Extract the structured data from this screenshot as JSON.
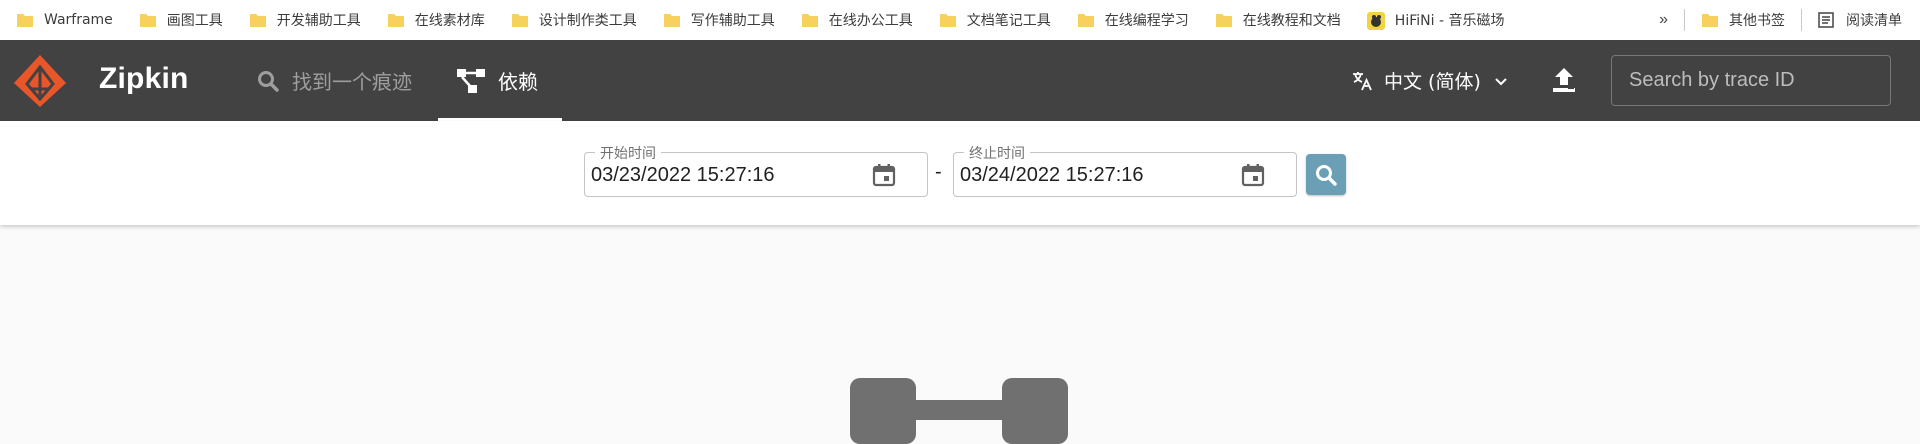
{
  "bookmarks": {
    "items": [
      {
        "label": "Warframe"
      },
      {
        "label": "画图工具"
      },
      {
        "label": "开发辅助工具"
      },
      {
        "label": "在线素材库"
      },
      {
        "label": "设计制作类工具"
      },
      {
        "label": "写作辅助工具"
      },
      {
        "label": "在线办公工具"
      },
      {
        "label": "文档笔记工具"
      },
      {
        "label": "在线编程学习"
      },
      {
        "label": "在线教程和文档"
      },
      {
        "label": "HiFiNi - 音乐磁场"
      }
    ],
    "more": "»",
    "other": "其他书签",
    "reading_list": "阅读清单"
  },
  "header": {
    "brand": "Zipkin",
    "tab_search": "找到一个痕迹",
    "tab_dependencies": "依赖",
    "language": "中文 (简体)",
    "search_placeholder": "Search by trace ID"
  },
  "toolbar": {
    "start_label": "开始时间",
    "start_value": "03/23/2022 15:27:16",
    "separator": "-",
    "end_label": "终止时间",
    "end_value": "03/24/2022 15:27:16"
  },
  "colors": {
    "header_bg": "#424242",
    "accent": "#6a9fb5",
    "logo_orange": "#e8562a"
  }
}
